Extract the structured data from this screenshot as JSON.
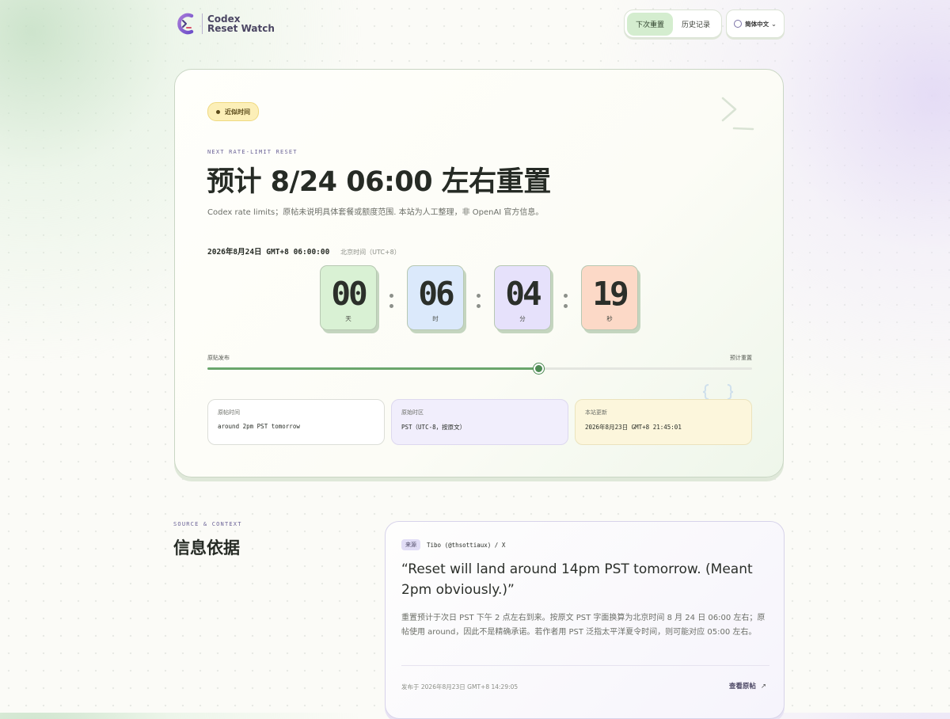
{
  "app": {
    "logo_line1": "Codex",
    "logo_line2": "Reset Watch"
  },
  "nav": {
    "tabs": [
      {
        "label": "下次重置",
        "active": true
      },
      {
        "label": "历史记录",
        "active": false
      }
    ],
    "language": "简体中文"
  },
  "hero": {
    "pill": "近似时间",
    "eyebrow": "NEXT RATE-LIMIT RESET",
    "title": "预计 8/24 06:00 左右重置",
    "subtitle": "Codex rate limits；原帖未说明具体套餐或额度范围. 本站为人工整理，非 OpenAI 官方信息。",
    "target_time": "2026年8月24日 GMT+8 06:00:00",
    "target_tz": "北京时间（UTC+8）",
    "countdown": [
      {
        "value": "00",
        "unit": "天"
      },
      {
        "value": "06",
        "unit": "时"
      },
      {
        "value": "04",
        "unit": "分"
      },
      {
        "value": "19",
        "unit": "秒"
      }
    ],
    "progress": {
      "start_label": "原贴发布",
      "end_label": "预计重置",
      "fraction": 0.608
    },
    "info_cards": [
      {
        "label": "原帖时间",
        "value": "around 2pm PST tomorrow"
      },
      {
        "label": "原始时区",
        "value": "PST（UTC-8，按原文）"
      },
      {
        "label": "本站更新",
        "value": "2026年8月23日 GMT+8 21:45:01"
      }
    ]
  },
  "source": {
    "eyebrow": "SOURCE & CONTEXT",
    "title": "信息依据",
    "badge": "来源",
    "author": "Tibo (@thsottiaux) / X",
    "quote": "“Reset will land around 14pm PST tomorrow. (Meant 2pm obviously.)”",
    "body": "重置预计于次日 PST 下午 2 点左右到来。按原文 PST 字面换算为北京时间 8 月 24 日 06:00 左右；原帖使用 around，因此不是精确承诺。若作者用 PST 泛指太平洋夏令时间，则可能对应 05:00 左右。",
    "posted": "发布于 2026年8月23日 GMT+8 14:29:05",
    "link_label": "查看原帖",
    "link_icon": "external-arrow-icon"
  },
  "colors": {
    "accent_green": "#6aa66c",
    "countdown_days": "#d9f1d4",
    "countdown_hours": "#dbe9fb",
    "countdown_minutes": "#e6e1fb",
    "countdown_seconds": "#fcd9c7"
  }
}
